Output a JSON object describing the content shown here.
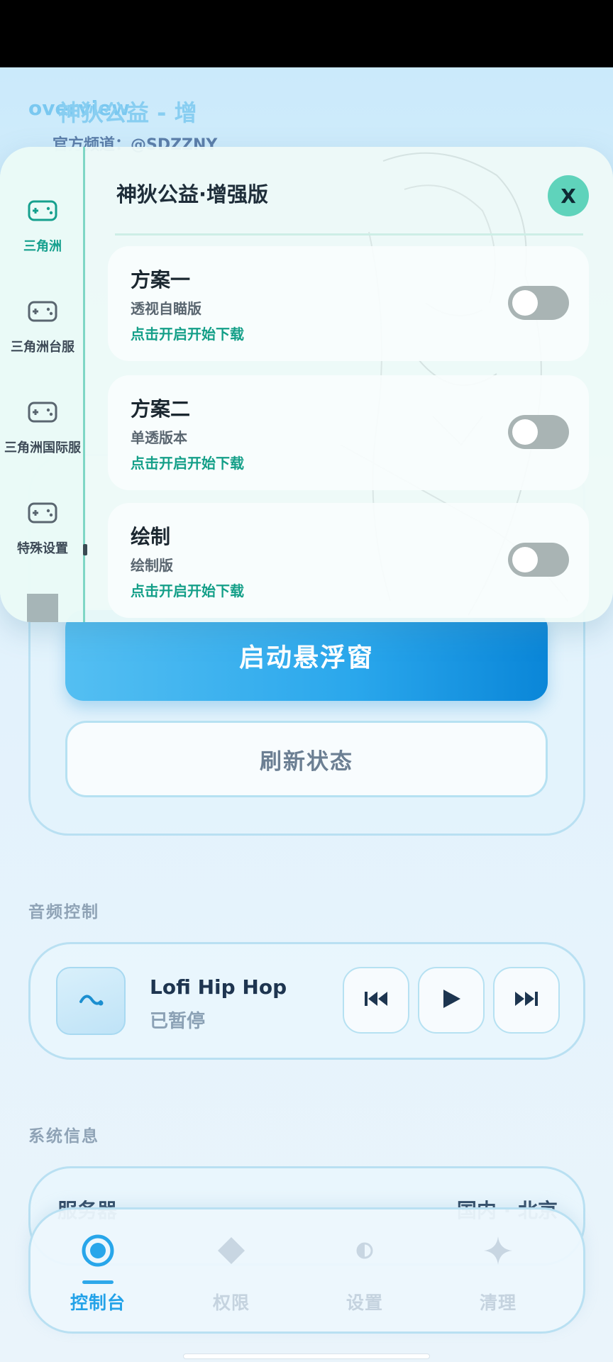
{
  "header": {
    "bg_title_left": "overview",
    "bg_title_overlap": "神狄公益 - 增",
    "channel": "官方频道：@SDZZNY"
  },
  "main": {
    "launch_button": "启动悬浮窗",
    "refresh_button": "刷新状态"
  },
  "audio": {
    "section_title": "音频控制",
    "track_name": "Lofi Hip Hop",
    "status": "已暂停",
    "icons": [
      "music-note-icon",
      "previous-icon",
      "play-icon",
      "next-icon"
    ]
  },
  "system": {
    "section_title": "系统信息",
    "rows": [
      {
        "label": "服务器",
        "value": "国内 · 北京"
      }
    ]
  },
  "nav": {
    "items": [
      {
        "label": "控制台",
        "icon": "target-icon",
        "active": true
      },
      {
        "label": "权限",
        "icon": "diamond-icon",
        "active": false
      },
      {
        "label": "设置",
        "icon": "half-circle-icon",
        "active": false
      },
      {
        "label": "清理",
        "icon": "sparkle-icon",
        "active": false
      }
    ]
  },
  "modal": {
    "title": "神狄公益·增强版",
    "close_label": "X",
    "sidebar": [
      {
        "label": "三角洲",
        "icon": "gamepad-icon",
        "active": true
      },
      {
        "label": "三角洲台服",
        "icon": "gamepad-icon",
        "active": false
      },
      {
        "label": "三角洲国际服",
        "icon": "gamepad-icon",
        "active": false
      },
      {
        "label": "特殊设置",
        "icon": "gamepad-icon",
        "active": false
      }
    ],
    "options": [
      {
        "title": "方案一",
        "subtitle": "透视自瞄版",
        "action": "点击开启开始下载",
        "enabled": false
      },
      {
        "title": "方案二",
        "subtitle": "单透版本",
        "action": "点击开启开始下载",
        "enabled": false
      },
      {
        "title": "绘制",
        "subtitle": "绘制版",
        "action": "点击开启开始下载",
        "enabled": false
      }
    ]
  },
  "colors": {
    "accent": "#2aa7ec",
    "modal_accent": "#16a08e",
    "close_button": "#5fd3bb",
    "toggle_off": "#a9b4b4"
  }
}
